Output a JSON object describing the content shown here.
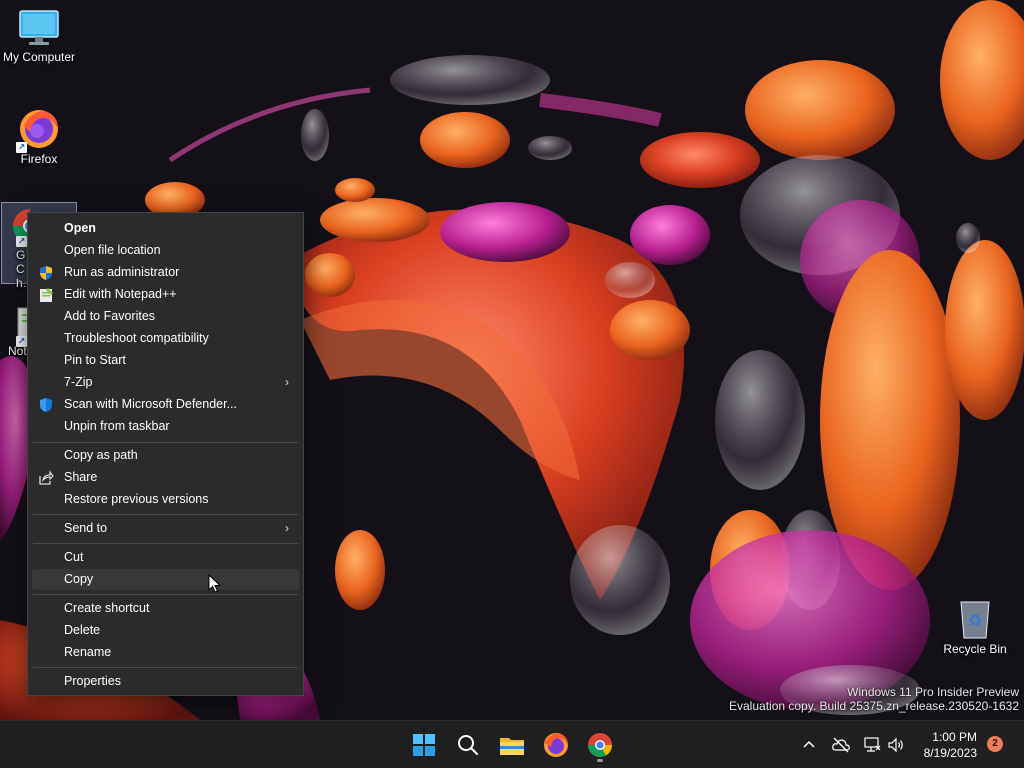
{
  "desktop": {
    "icons": [
      {
        "label": "My Computer"
      },
      {
        "label": "Firefox"
      },
      {
        "label": "G… Ch…"
      },
      {
        "label": "Not…"
      },
      {
        "label": "Recycle Bin"
      }
    ],
    "watermark": {
      "line1": "Windows 11 Pro Insider Preview",
      "line2": "Evaluation copy. Build 25375.zn_release.230520-1632"
    }
  },
  "context_menu": {
    "items": [
      {
        "label": "Open",
        "bold": true
      },
      {
        "label": "Open file location"
      },
      {
        "label": "Run as administrator",
        "icon": "uac-shield-icon"
      },
      {
        "label": "Edit with Notepad++",
        "icon": "notepad-plus-plus-icon"
      },
      {
        "label": "Add to Favorites"
      },
      {
        "label": "Troubleshoot compatibility"
      },
      {
        "label": "Pin to Start"
      },
      {
        "label": "7-Zip",
        "submenu": true
      },
      {
        "label": "Scan with Microsoft Defender...",
        "icon": "defender-shield-icon"
      },
      {
        "label": "Unpin from taskbar"
      },
      {
        "label": "Copy as path"
      },
      {
        "label": "Share",
        "icon": "share-icon"
      },
      {
        "label": "Restore previous versions"
      },
      {
        "label": "Send to",
        "submenu": true
      },
      {
        "label": "Cut"
      },
      {
        "label": "Copy",
        "hovered": true
      },
      {
        "label": "Create shortcut"
      },
      {
        "label": "Delete"
      },
      {
        "label": "Rename"
      },
      {
        "label": "Properties"
      }
    ],
    "submenu_arrow": "›"
  },
  "taskbar": {
    "apps": [
      "windows-start-icon",
      "search-icon",
      "file-explorer-icon",
      "firefox-icon",
      "chrome-icon"
    ],
    "tray": {
      "time": "1:00 PM",
      "date": "8/19/2023",
      "notification_count": "2"
    }
  },
  "colors": {
    "menu_bg": "#2b2b2b",
    "menu_hover": "#383838",
    "taskbar_bg": "#1f1f1f",
    "accent": "#0078d4"
  }
}
